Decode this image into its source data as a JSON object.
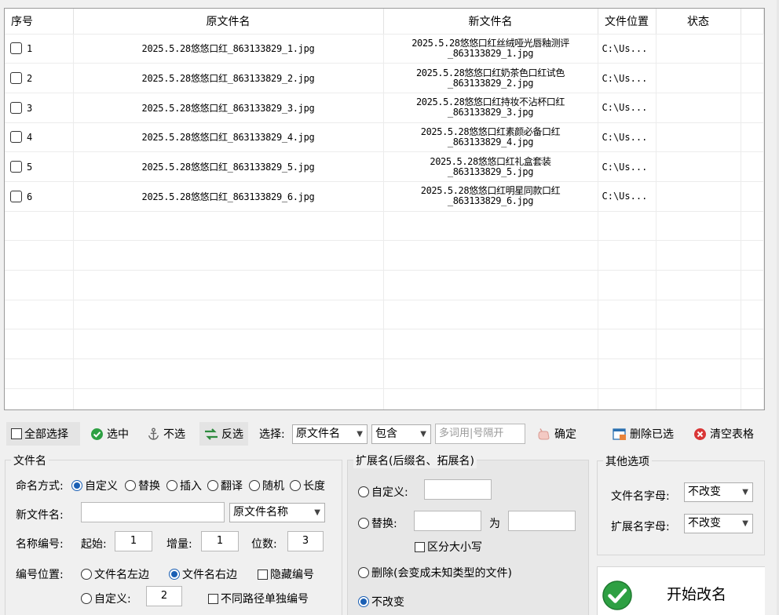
{
  "grid": {
    "columns": [
      "序号",
      "原文件名",
      "新文件名",
      "文件位置",
      "状态",
      ""
    ],
    "rows": [
      {
        "seq": "1",
        "orig": "2025.5.28悠悠口红_863133829_1.jpg",
        "new_line1": "2025.5.28悠悠口红丝绒哑光唇釉测评",
        "new_line2": "_863133829_1.jpg",
        "location": "C:\\Us...",
        "status": ""
      },
      {
        "seq": "2",
        "orig": "2025.5.28悠悠口红_863133829_2.jpg",
        "new_line1": "2025.5.28悠悠口红奶茶色口红试色",
        "new_line2": "_863133829_2.jpg",
        "location": "C:\\Us...",
        "status": ""
      },
      {
        "seq": "3",
        "orig": "2025.5.28悠悠口红_863133829_3.jpg",
        "new_line1": "2025.5.28悠悠口红持妆不沾杯口红",
        "new_line2": "_863133829_3.jpg",
        "location": "C:\\Us...",
        "status": ""
      },
      {
        "seq": "4",
        "orig": "2025.5.28悠悠口红_863133829_4.jpg",
        "new_line1": "2025.5.28悠悠口红素颜必备口红",
        "new_line2": "_863133829_4.jpg",
        "location": "C:\\Us...",
        "status": ""
      },
      {
        "seq": "5",
        "orig": "2025.5.28悠悠口红_863133829_5.jpg",
        "new_line1": "2025.5.28悠悠口红礼盒套装",
        "new_line2": "_863133829_5.jpg",
        "location": "C:\\Us...",
        "status": ""
      },
      {
        "seq": "6",
        "orig": "2025.5.28悠悠口红_863133829_6.jpg",
        "new_line1": "2025.5.28悠悠口红明星同款口红",
        "new_line2": "_863133829_6.jpg",
        "location": "C:\\Us...",
        "status": ""
      }
    ]
  },
  "toolbar": {
    "select_all": "全部选择",
    "check": "选中",
    "uncheck": "不选",
    "invert": "反选",
    "select_label": "选择:",
    "field_value": "原文件名",
    "match_value": "包含",
    "keyword_placeholder": "多词用|号隔开",
    "confirm": "确定",
    "delete_selected": "删除已选",
    "clear_table": "清空表格"
  },
  "filename_group": {
    "title": "文件名",
    "mode_label": "命名方式:",
    "modes": [
      "自定义",
      "替换",
      "插入",
      "翻译",
      "随机",
      "长度"
    ],
    "selected_mode": "自定义",
    "new_name_label": "新文件名:",
    "new_name_value": "",
    "source_value": "原文件名称",
    "numbering_label": "名称编号:",
    "start_label": "起始:",
    "start_value": "1",
    "step_label": "增量:",
    "step_value": "1",
    "digits_label": "位数:",
    "digits_value": "3",
    "position_label": "编号位置:",
    "pos_left": "文件名左边",
    "pos_right": "文件名右边",
    "hide_number": "隐藏编号",
    "pos_custom": "自定义:",
    "custom_value": "2",
    "separate_paths": "不同路径单独编号"
  },
  "ext_group": {
    "title": "扩展名(后缀名、拓展名)",
    "custom": "自定义:",
    "replace": "替换:",
    "to_label": "为",
    "case_sensitive": "区分大小写",
    "delete": "删除(会变成未知类型的文件)",
    "unchanged": "不改变"
  },
  "other_group": {
    "title": "其他选项",
    "filename_case_label": "文件名字母:",
    "filename_case_value": "不改变",
    "ext_case_label": "扩展名字母:",
    "ext_case_value": "不改变"
  },
  "start_button": "开始改名",
  "colors": {
    "accent": "#1a5fb4",
    "green": "#2ea043",
    "red": "#d93636"
  }
}
